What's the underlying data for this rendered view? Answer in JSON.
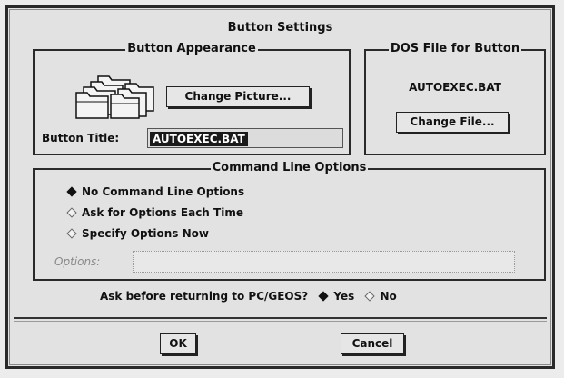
{
  "dialog": {
    "title": "Button Settings",
    "appearance": {
      "legend": "Button Appearance",
      "change_picture_label": "Change Picture...",
      "button_title_label": "Button Title:",
      "button_title_value": "AUTOEXEC.BAT"
    },
    "dos_file": {
      "legend": "DOS File for Button",
      "file_name": "AUTOEXEC.BAT",
      "change_file_label": "Change File..."
    },
    "command_line": {
      "legend": "Command Line Options",
      "options": [
        {
          "label": "No Command Line Options",
          "selected": true
        },
        {
          "label": "Ask for Options Each Time",
          "selected": false
        },
        {
          "label": "Specify Options Now",
          "selected": false
        }
      ],
      "options_field_label": "Options:",
      "options_field_value": ""
    },
    "ask_before_return": {
      "label": "Ask before returning to PC/GEOS?",
      "yes_label": "Yes",
      "no_label": "No",
      "selected": "Yes"
    },
    "ok_label": "OK",
    "cancel_label": "Cancel",
    "icons": {
      "picture": "folder-stack-icon",
      "radio_on": "diamond-filled",
      "radio_off": "diamond-outline"
    }
  }
}
